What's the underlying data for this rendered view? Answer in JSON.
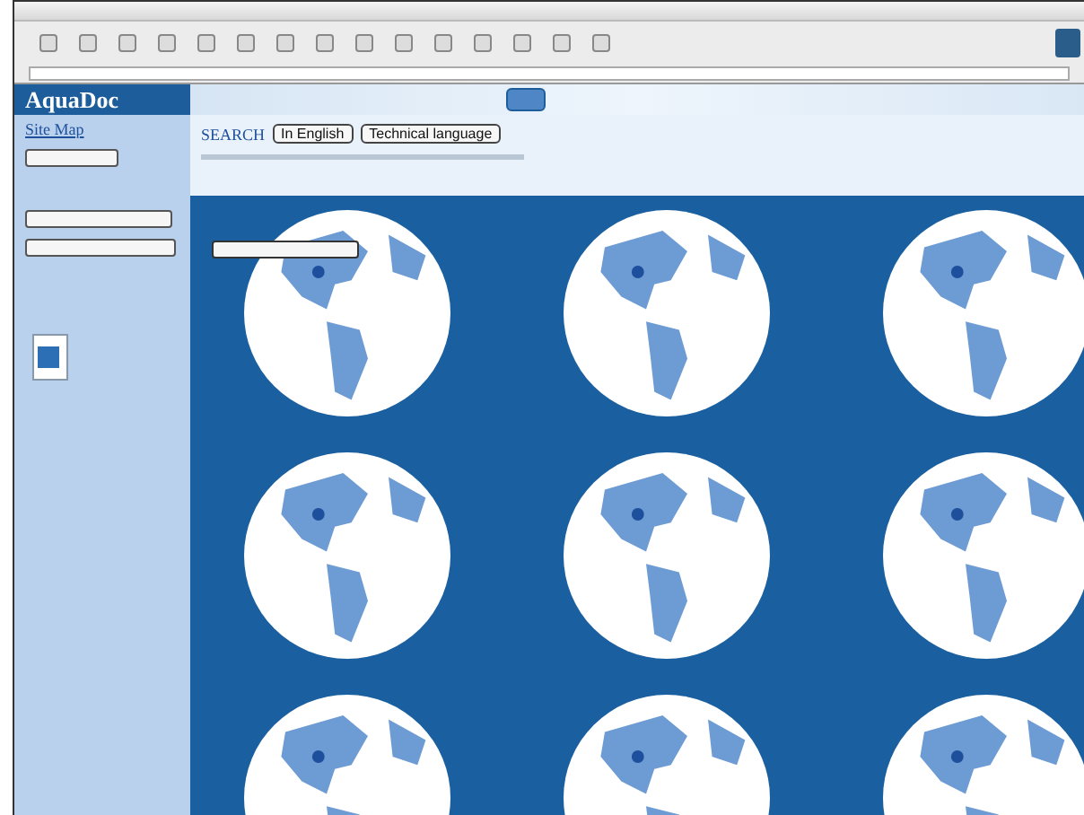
{
  "header": {
    "logo": "AquaDoc",
    "site_link": "Site Map"
  },
  "search": {
    "label": "SEARCH",
    "language": "In English",
    "register": "Technical language"
  }
}
